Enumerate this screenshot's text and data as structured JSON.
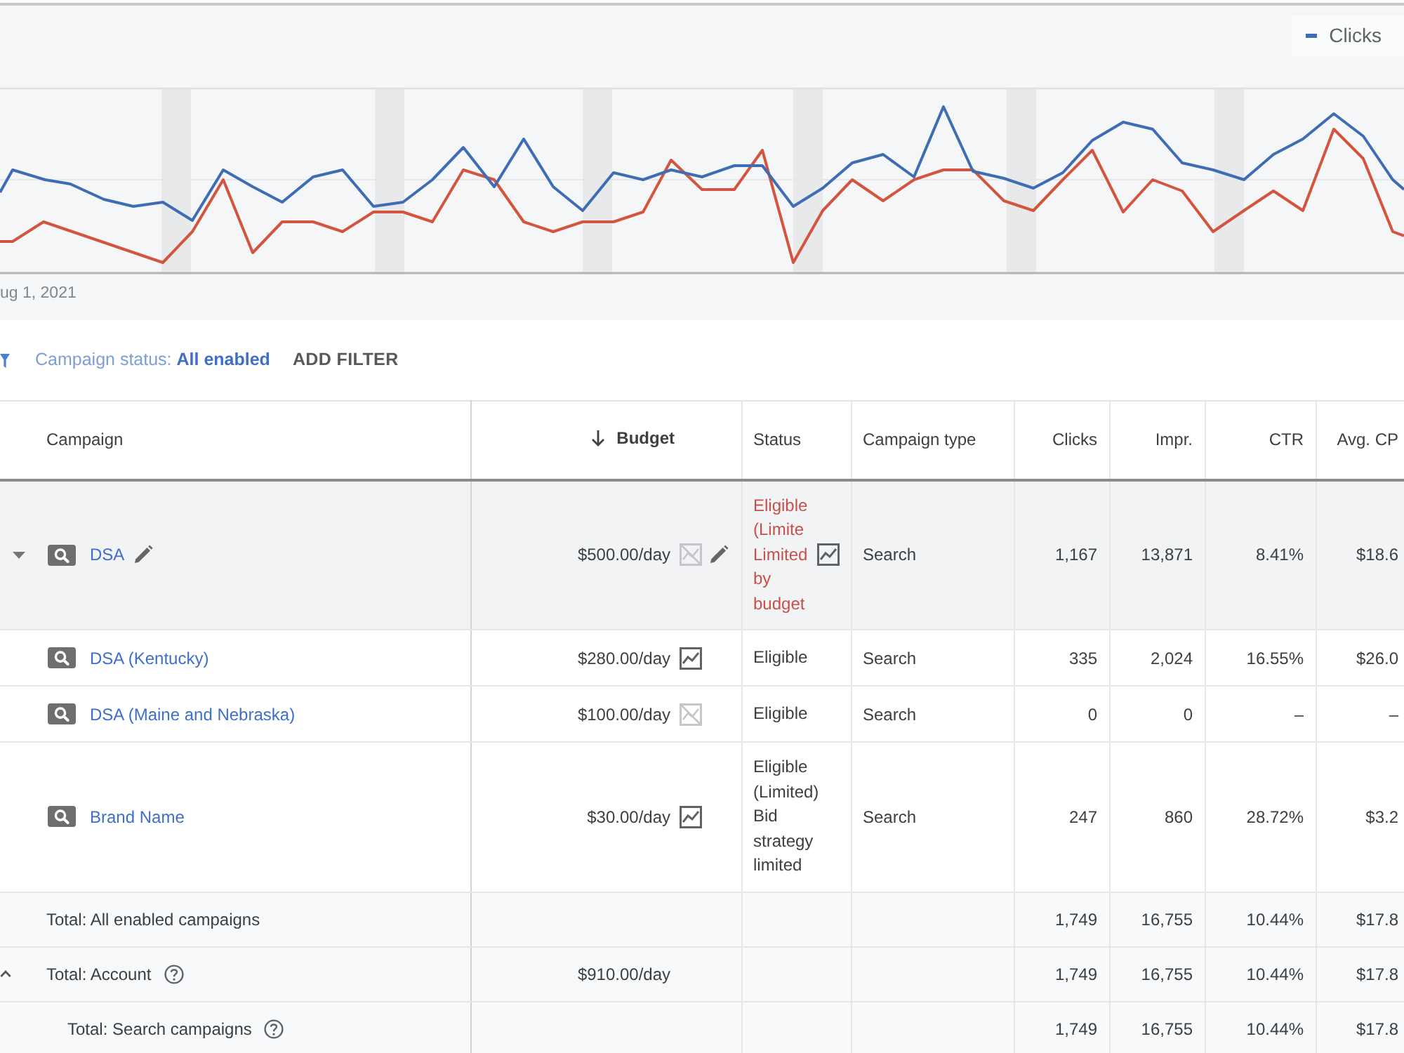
{
  "chart": {
    "legend": [
      "Clicks"
    ],
    "axis_label": "ug 1, 2021"
  },
  "filter": {
    "label": "Campaign status: **All enabled**",
    "add_button": "ADD FILTER"
  },
  "table": {
    "columns": [
      {
        "label": "Campaign",
        "sorted": false
      },
      {
        "label": "Budget",
        "sorted": true
      },
      {
        "label": "Status",
        "sorted": false
      },
      {
        "label": "Campaign type",
        "sorted": false
      },
      {
        "label": "Clicks",
        "sorted": false
      },
      {
        "label": "Impr.",
        "sorted": false
      },
      {
        "label": "CTR",
        "sorted": false
      },
      {
        "label": "Avg. CP",
        "sorted": false
      }
    ],
    "rows": [
      {
        "name": "DSA",
        "hovered": true,
        "budget": "$500.00/day",
        "budget_chart_enabled": false,
        "status": "Eligible (Limite",
        "status_detail": "Limited by budget",
        "warning": true,
        "status_chart": true,
        "campaign_type": "Search",
        "clicks": "1,167",
        "impr": "13,871",
        "ctr": "8.41%",
        "avg_cpc": "$18.6"
      },
      {
        "name": "DSA (Kentucky)",
        "hovered": false,
        "budget": "$280.00/day",
        "budget_chart_enabled": true,
        "status": "Eligible",
        "warning": false,
        "status_chart": false,
        "campaign_type": "Search",
        "clicks": "335",
        "impr": "2,024",
        "ctr": "16.55%",
        "avg_cpc": "$26.0"
      },
      {
        "name": "DSA (Maine and Nebraska)",
        "hovered": false,
        "budget": "$100.00/day",
        "budget_chart_enabled": false,
        "status": "Eligible",
        "warning": false,
        "status_chart": false,
        "campaign_type": "Search",
        "clicks": "0",
        "impr": "0",
        "ctr": "–",
        "avg_cpc": "–"
      },
      {
        "name": "Brand Name",
        "hovered": false,
        "budget": "$30.00/day",
        "budget_chart_enabled": true,
        "status": "Eligible (Limited)",
        "status_detail": "Bid strategy limited",
        "warning": false,
        "status_chart": false,
        "campaign_type": "Search",
        "clicks": "247",
        "impr": "860",
        "ctr": "28.72%",
        "avg_cpc": "$3.2"
      }
    ],
    "totals": [
      {
        "label": "Total: All enabled campaigns",
        "help": false,
        "clicks": "1,749",
        "impr": "16,755",
        "ctr": "10.44%",
        "avg_cpc": "$17.8"
      },
      {
        "label": "Total: Account",
        "help": true,
        "budget": "$910.00/day",
        "clicks": "1,749",
        "impr": "16,755",
        "ctr": "10.44%",
        "avg_cpc": "$17.8",
        "children": [
          {
            "label": "Total: Search campaigns",
            "help": true,
            "clicks": "1,749",
            "impr": "16,755",
            "ctr": "10.44%",
            "avg_cpc": "$17.8"
          }
        ]
      }
    ]
  }
}
